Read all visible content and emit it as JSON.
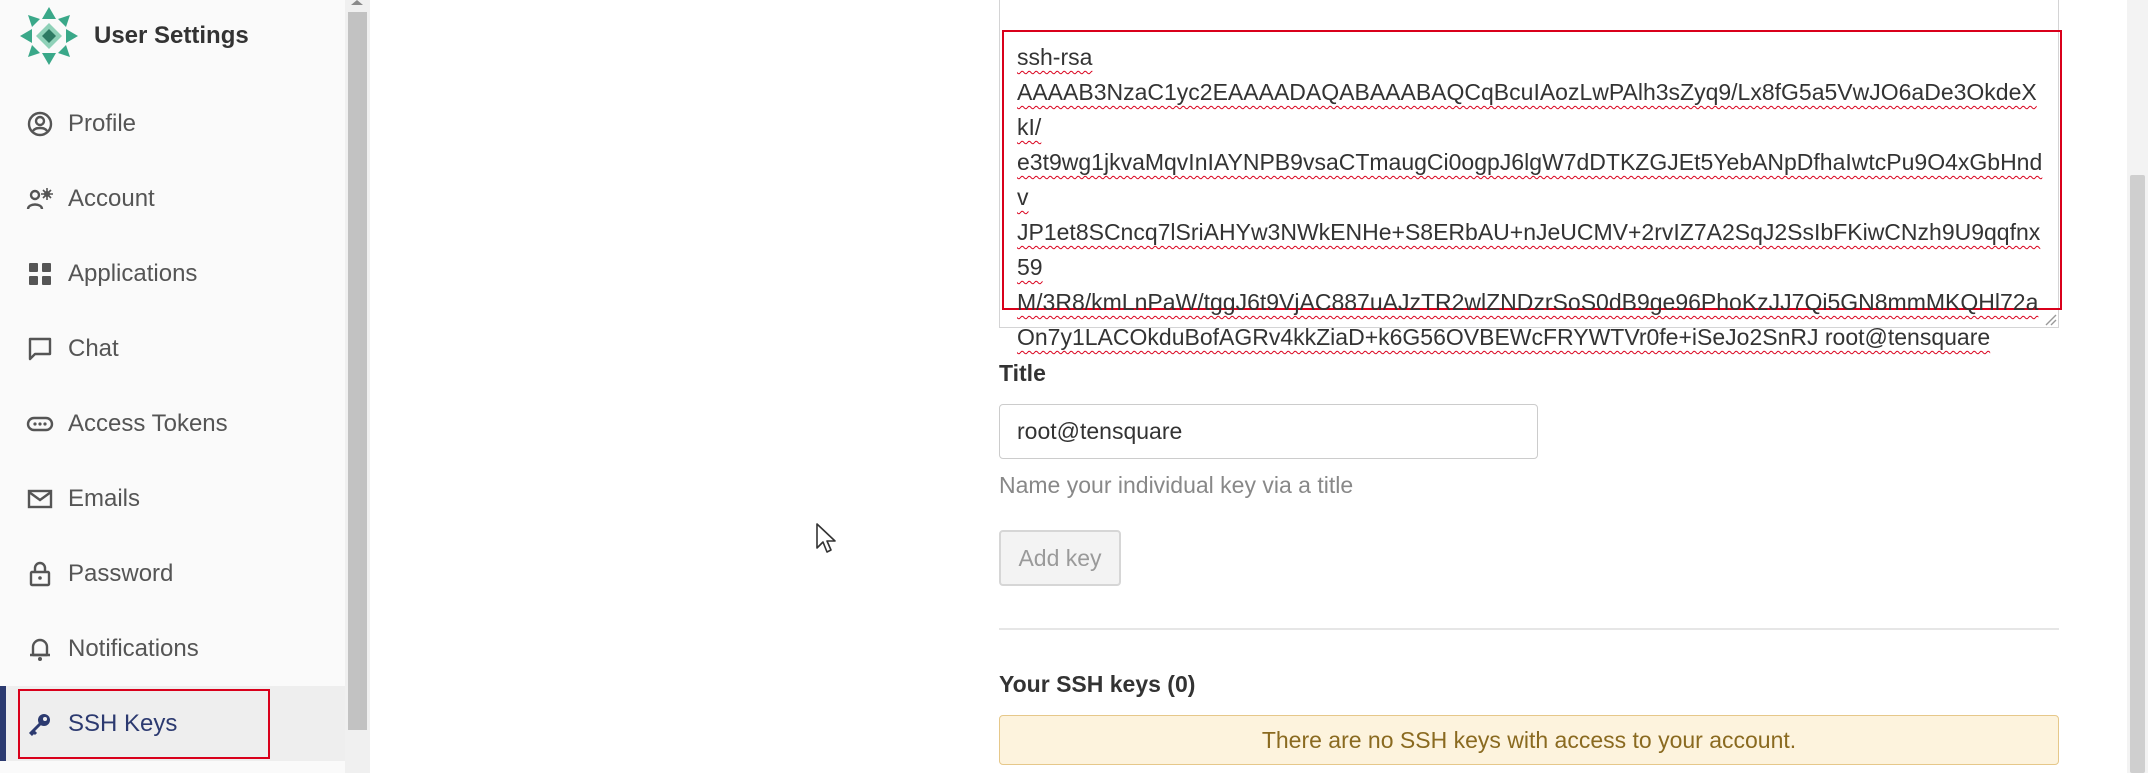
{
  "app": {
    "title": "User Settings"
  },
  "sidebar": {
    "items": [
      {
        "label": "Profile",
        "icon": "profile-icon"
      },
      {
        "label": "Account",
        "icon": "account-icon"
      },
      {
        "label": "Applications",
        "icon": "applications-icon"
      },
      {
        "label": "Chat",
        "icon": "chat-icon"
      },
      {
        "label": "Access Tokens",
        "icon": "access-tokens-icon"
      },
      {
        "label": "Emails",
        "icon": "emails-icon"
      },
      {
        "label": "Password",
        "icon": "password-icon"
      },
      {
        "label": "Notifications",
        "icon": "notifications-icon"
      },
      {
        "label": "SSH Keys",
        "icon": "key-icon",
        "active": true
      }
    ]
  },
  "form": {
    "key_value": "ssh-rsa\nAAAAB3NzaC1yc2EAAAADAQABAAABAQCqBcuIAozLwPAlh3sZyq9/Lx8fG5a5VwJO6aDe3OkdeXkI/\ne3t9wg1jkvaMqvInIAYNPB9vsaCTmaugCi0ogpJ6lgW7dDTKZGJEt5YebANpDfhaIwtcPu9O4xGbHndv\nJP1et8SCncq7lSriAHYw3NWkENHe+S8ERbAU+nJeUCMV+2rvIZ7A2SqJ2SsIbFKiwCNzh9U9qqfnx59\nM/3R8/kmLnPaW/tggJ6t9VjAC887uAJzTR2wlZNDzrSoS0dB9ge96PhoKzJJ7Qi5GN8mmMKQHl72a\nOn7y1LACOkduBofAGRv4kkZiaD+k6G56OVBEWcFRYWTVr0fe+iSeJo2SnRJ root@tensquare",
    "title_label": "Title",
    "title_value": "root@tensquare",
    "title_help": "Name your individual key via a title",
    "add_button": "Add key"
  },
  "keys": {
    "heading": "Your SSH keys (0)",
    "empty_notice": "There are no SSH keys with access to your account."
  },
  "colors": {
    "highlight": "#d9001b",
    "active_accent": "#2c3a70",
    "notice_bg": "#fdf3dd"
  }
}
